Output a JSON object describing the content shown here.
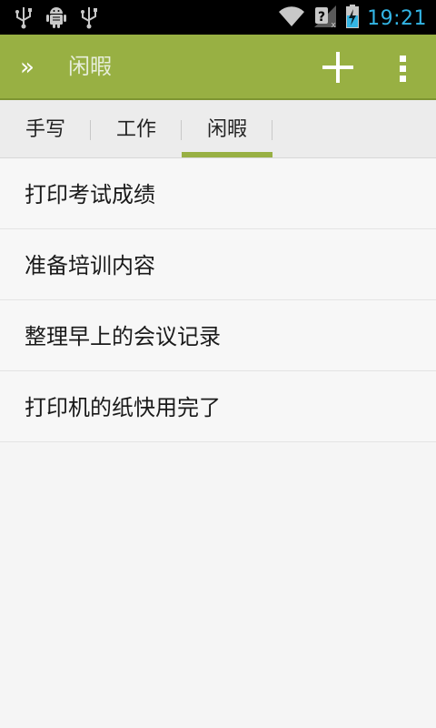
{
  "status_bar": {
    "time": "19:21",
    "icons": [
      "usb-icon",
      "android-debug-icon",
      "usb-icon",
      "wifi-icon",
      "signal-no-sim-icon",
      "battery-charging-icon"
    ]
  },
  "action_bar": {
    "nav_glyph": "»",
    "title": "闲暇",
    "background_color": "#98b043",
    "title_color": "#e7eedb"
  },
  "tabs": [
    {
      "label": "手写"
    },
    {
      "label": "工作"
    },
    {
      "label": "闲暇"
    }
  ],
  "selected_tab": "闲暇",
  "list": {
    "items": [
      {
        "label": "打印考试成绩"
      },
      {
        "label": "准备培训内容"
      },
      {
        "label": "整理早上的会议记录"
      },
      {
        "label": "打印机的纸快用完了"
      }
    ]
  }
}
